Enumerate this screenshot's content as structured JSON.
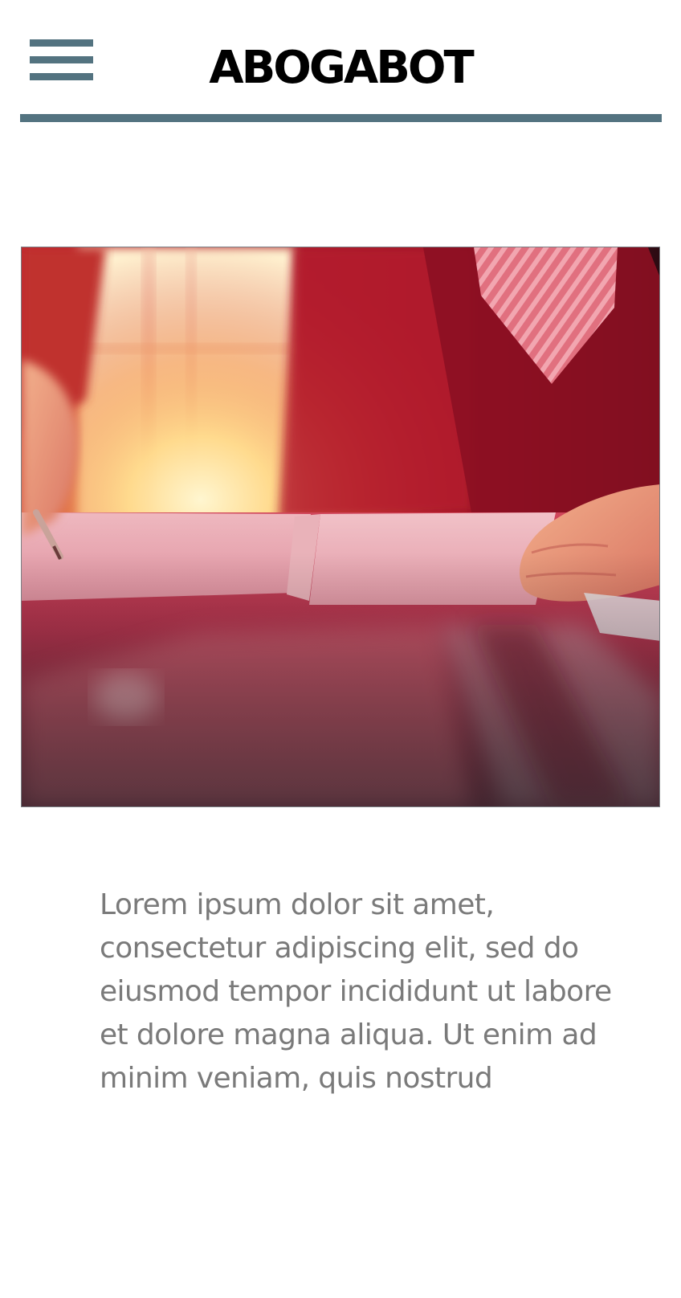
{
  "header": {
    "menu_icon": "hamburger-menu-icon",
    "brand": "ABOGABOT",
    "accent_color": "#537380"
  },
  "hero": {
    "icon": "photo-contract-signing"
  },
  "content": {
    "paragraph": "Lorem ipsum dolor sit amet, consectetur adipiscing elit, sed do eiusmod tempor incididunt ut labore et dolore magna aliqua. Ut enim ad minim veniam, quis nostrud"
  }
}
